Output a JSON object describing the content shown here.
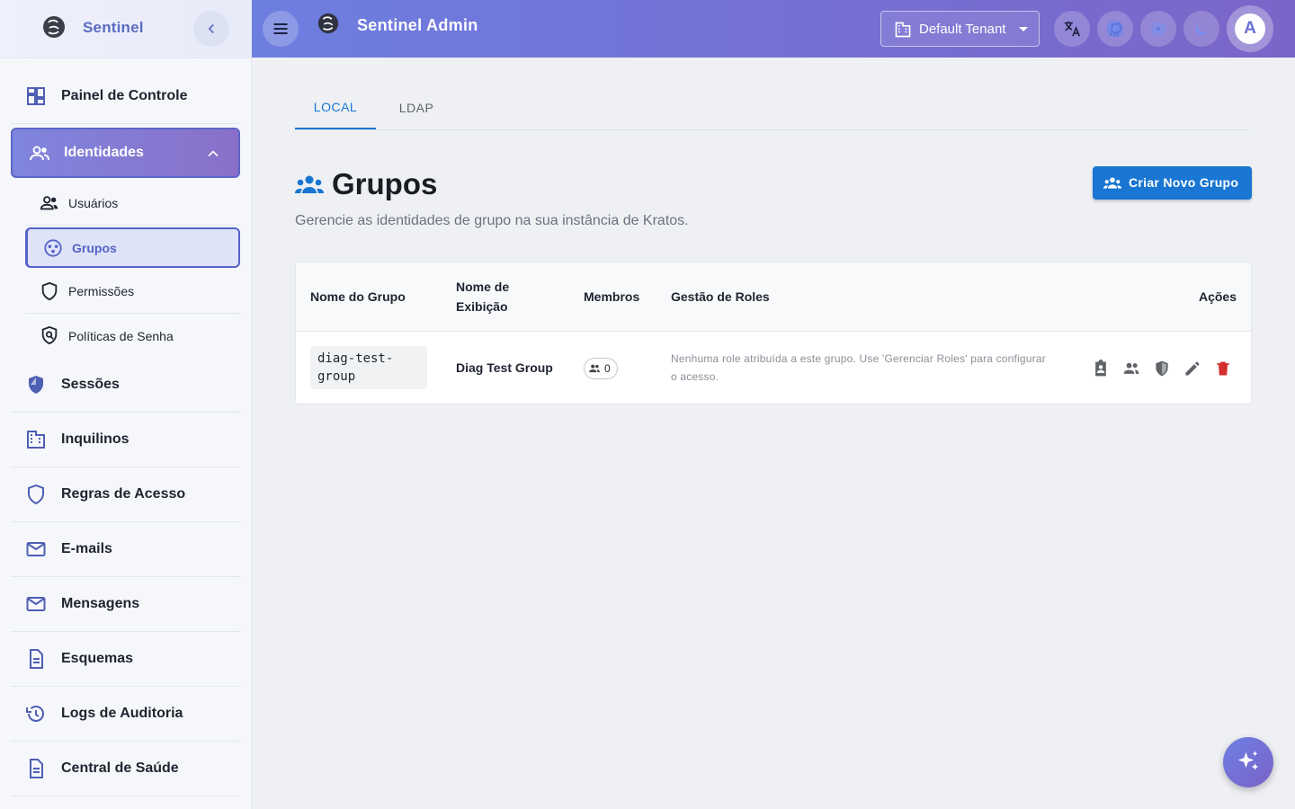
{
  "sidebar": {
    "brand": "Sentinel",
    "items_top": [
      {
        "label": "Painel de Controle",
        "icon": "dashboard-icon"
      }
    ],
    "active_group": {
      "label": "Identidades",
      "icon": "people-icon"
    },
    "sub_items": [
      {
        "label": "Usuários",
        "icon": "users-icon"
      },
      {
        "label": "Grupos",
        "icon": "groups-icon"
      },
      {
        "label": "Permissões",
        "icon": "shield-icon"
      },
      {
        "label": "Políticas de Senha",
        "icon": "policy-icon"
      }
    ],
    "items_bottom": [
      {
        "label": "Sessões",
        "icon": "security-icon"
      },
      {
        "label": "Inquilinos",
        "icon": "domain-icon"
      },
      {
        "label": "Regras de Acesso",
        "icon": "shield-outline-icon"
      },
      {
        "label": "E-mails",
        "icon": "mail-icon"
      },
      {
        "label": "Mensagens",
        "icon": "mail-outline-icon"
      },
      {
        "label": "Esquemas",
        "icon": "document-icon"
      },
      {
        "label": "Logs de Auditoria",
        "icon": "history-icon"
      },
      {
        "label": "Central de Saúde",
        "icon": "health-document-icon"
      }
    ]
  },
  "topbar": {
    "title": "Sentinel Admin",
    "tenant": "Default Tenant",
    "avatar_letter": "A"
  },
  "tabs": [
    {
      "label": "LOCAL",
      "active": true
    },
    {
      "label": "LDAP",
      "active": false
    }
  ],
  "page": {
    "title": "Grupos",
    "subtitle": "Gerencie as identidades de grupo na sua instância de Kratos.",
    "create_button": "Criar Novo Grupo"
  },
  "table": {
    "headers": {
      "name": "Nome do Grupo",
      "display": "Nome de Exibição",
      "members": "Membros",
      "roles": "Gestão de Roles",
      "actions": "Ações"
    },
    "rows": [
      {
        "name": "diag-test-group",
        "display": "Diag Test Group",
        "members": "0",
        "roles_note": "Nenhuma role atribuída a este grupo. Use 'Gerenciar Roles' para configurar o acesso."
      }
    ]
  },
  "colors": {
    "accent": "#1976d2",
    "topbar_start": "#6d7ee0",
    "topbar_end": "#7b65c8",
    "delete": "#d32f2f"
  }
}
